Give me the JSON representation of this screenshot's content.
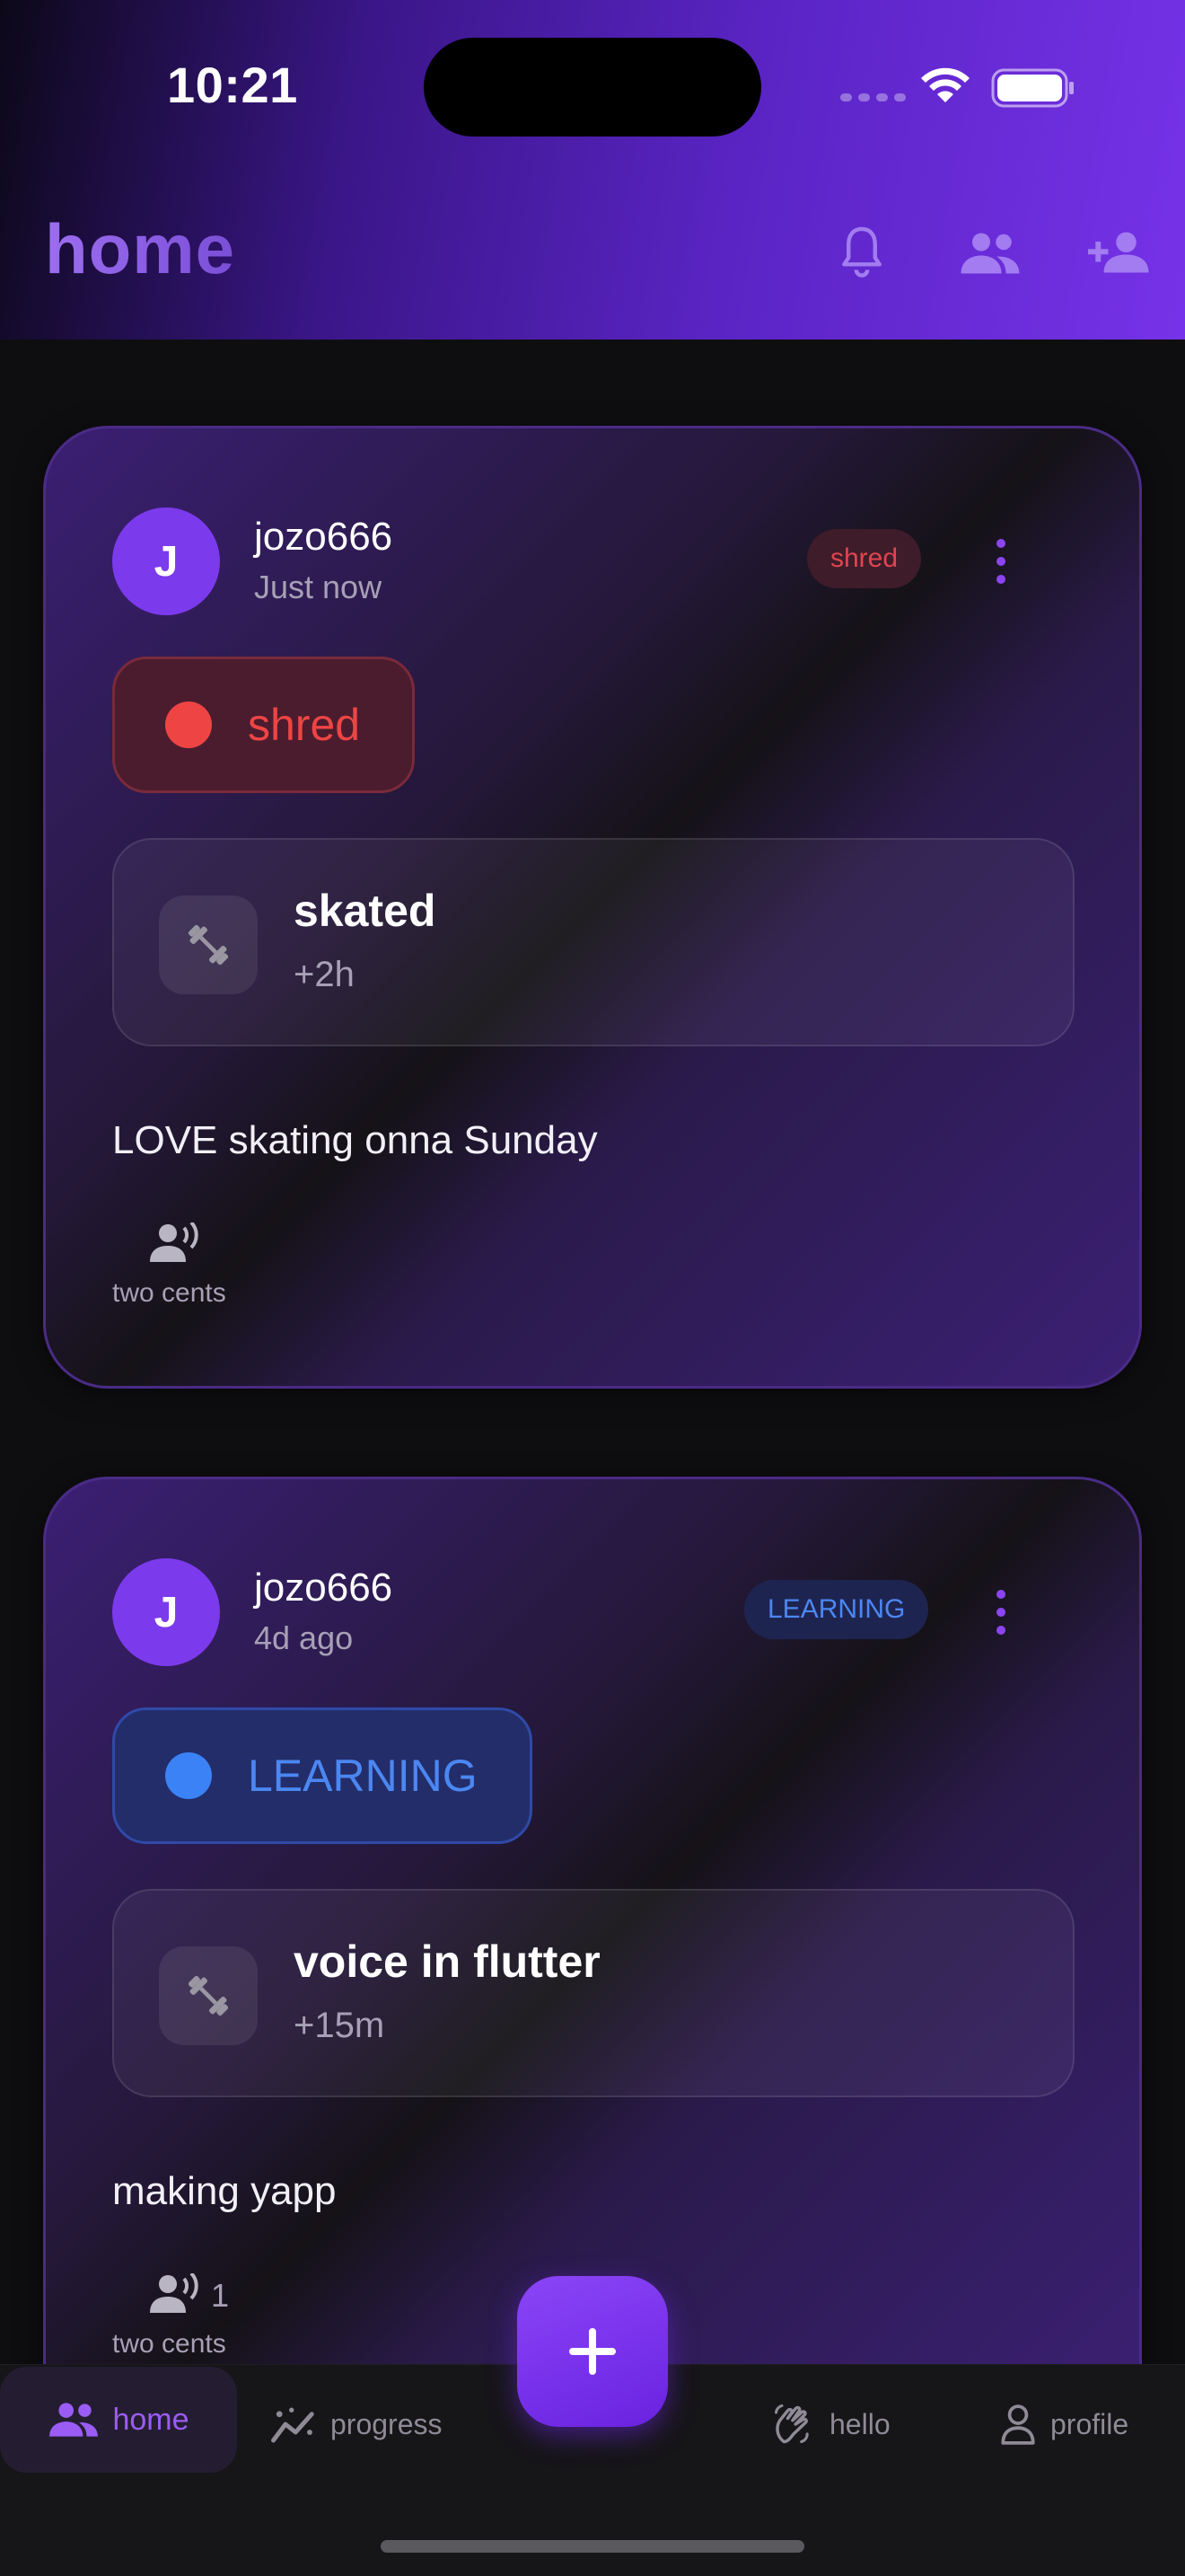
{
  "status_bar": {
    "time": "10:21"
  },
  "header": {
    "title": "home",
    "icons": [
      "bell-icon",
      "group-icon",
      "add-person-icon"
    ]
  },
  "posts": [
    {
      "avatar_initial": "J",
      "username": "jozo666",
      "time": "Just now",
      "tag": "shred",
      "status": "shred",
      "activity_name": "skated",
      "activity_duration": "+2h",
      "text": "LOVE skating onna Sunday",
      "reaction_count": "",
      "reaction_label": "two cents"
    },
    {
      "avatar_initial": "J",
      "username": "jozo666",
      "time": "4d ago",
      "tag": "LEARNING",
      "status": "LEARNING",
      "activity_name": "voice in flutter",
      "activity_duration": "+15m",
      "text": "making yapp",
      "reaction_count": "1",
      "reaction_label": "two cents"
    }
  ],
  "colors": {
    "accent": "#7c3aed",
    "shred": "#ef4444",
    "learning": "#3b82f6"
  },
  "bottom_nav": {
    "items": [
      {
        "label": "home",
        "icon": "group-icon",
        "active": true
      },
      {
        "label": "progress",
        "icon": "sparkline-icon",
        "active": false
      },
      {
        "label": "hello",
        "icon": "waving-hand-icon",
        "active": false
      },
      {
        "label": "profile",
        "icon": "person-icon",
        "active": false
      }
    ],
    "fab_icon": "plus-icon"
  }
}
